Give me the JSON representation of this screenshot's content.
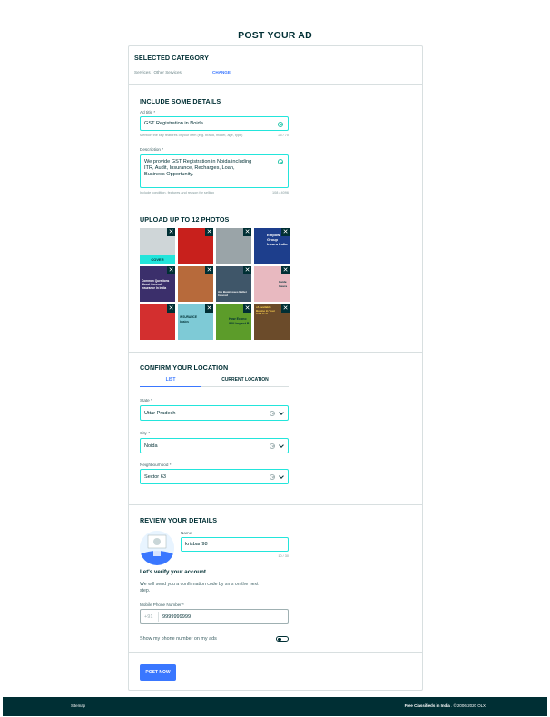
{
  "page": {
    "title": "POST YOUR AD"
  },
  "category": {
    "heading": "SELECTED CATEGORY",
    "path": "Services / Other Services",
    "change_label": "CHANGE"
  },
  "details": {
    "heading": "INCLUDE SOME DETAILS",
    "ad_title_label": "Ad title *",
    "ad_title_value": "GST Registration in Noida",
    "ad_title_hint": "Mention the key features of your item (e.g. brand, model, age, type)",
    "ad_title_count": "25 / 70",
    "description_label": "Description *",
    "description_lines": [
      "We provide GST Registration in Noida including",
      "ITR, Audit, Insurance, Recharges, Loan,",
      "Business Opportunity."
    ],
    "description_hint": "Include condition, features and reason for selling",
    "description_count": "108 / 4096"
  },
  "photos": {
    "heading": "UPLOAD UP TO 12 PHOTOS",
    "cover_label": "COVER",
    "close_glyph": "✕",
    "items": [
      {
        "color": "#cfd6d8",
        "text": ""
      },
      {
        "color": "#c8201c",
        "text": ""
      },
      {
        "color": "#9aa4a8",
        "text": ""
      },
      {
        "color": "#1d3e8c",
        "text": "Empow Group Insura India"
      },
      {
        "color": "#3b2f6b",
        "text": "Common Questions About General Insurance In India"
      },
      {
        "color": "#b76a3b",
        "text": ""
      },
      {
        "color": "#3f5669",
        "text": "Are Businesses Better Insured"
      },
      {
        "color": "#e8b9c0",
        "text": "Guide Insura"
      },
      {
        "color": "#d32f2f",
        "text": ""
      },
      {
        "color": "#7ecad6",
        "text": "INSURANCE basics"
      },
      {
        "color": "#5c9c2a",
        "text": "How Econo Will Impact B"
      },
      {
        "color": "#6b4b2a",
        "text": "of Available Busine in Your GST Coll"
      }
    ]
  },
  "location": {
    "heading": "CONFIRM YOUR LOCATION",
    "tab_list": "LIST",
    "tab_current": "CURRENT LOCATION",
    "state_label": "State *",
    "state_value": "Uttar Pradesh",
    "city_label": "City *",
    "city_value": "Noida",
    "neighbourhood_label": "Neighbourhood *",
    "neighbourhood_value": "Sector 63"
  },
  "review": {
    "heading": "REVIEW YOUR DETAILS",
    "name_label": "Name",
    "name_value": "krisbarf98",
    "name_count": "10 / 30",
    "verify_heading": "Let's verify your account",
    "verify_text_lines": [
      "We will send you a confirmation code by sms on the next",
      "step."
    ],
    "phone_label": "Mobile Phone Number *",
    "phone_prefix": "+91",
    "phone_value": "9999999999",
    "show_phone_label": "Show my phone number on my ads"
  },
  "actions": {
    "post_now": "POST NOW"
  },
  "footer": {
    "sitemap": "Sitemap",
    "brand": "Free Classifieds in India",
    "copyright": ". © 2006-2020 OLX"
  },
  "colors": {
    "accent": "#3a77ff",
    "field_border": "#23e5db",
    "dark": "#002f34",
    "valid": "#23c4a8"
  }
}
